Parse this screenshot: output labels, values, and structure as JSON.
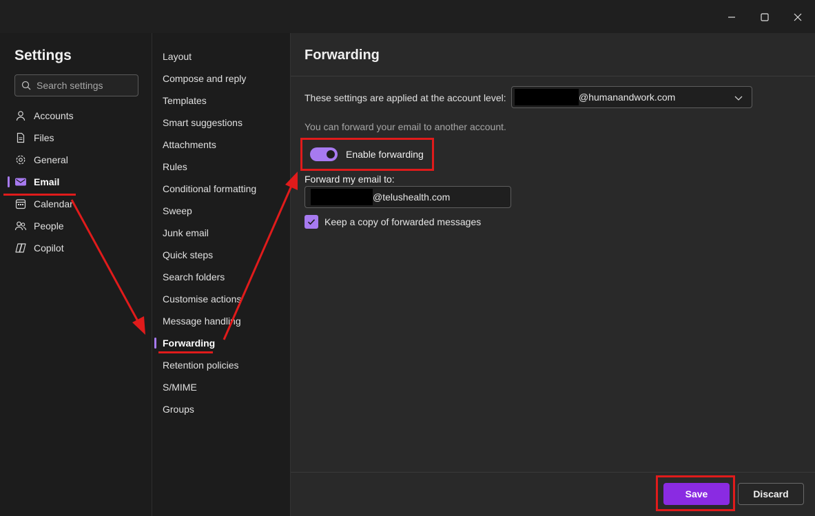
{
  "window": {
    "controls": [
      "minimize",
      "maximize",
      "close"
    ]
  },
  "settings": {
    "title": "Settings",
    "search_placeholder": "Search settings",
    "nav": [
      {
        "label": "Accounts",
        "icon": "person-icon"
      },
      {
        "label": "Files",
        "icon": "file-icon"
      },
      {
        "label": "General",
        "icon": "gear-icon"
      },
      {
        "label": "Email",
        "icon": "mail-icon",
        "active": true
      },
      {
        "label": "Calendar",
        "icon": "calendar-icon"
      },
      {
        "label": "People",
        "icon": "people-icon"
      },
      {
        "label": "Copilot",
        "icon": "copilot-icon"
      }
    ]
  },
  "email_menu": {
    "items": [
      "Layout",
      "Compose and reply",
      "Templates",
      "Smart suggestions",
      "Attachments",
      "Rules",
      "Conditional formatting",
      "Sweep",
      "Junk email",
      "Quick steps",
      "Search folders",
      "Customise actions",
      "Message handling",
      "Forwarding",
      "Retention policies",
      "S/MIME",
      "Groups"
    ],
    "active": "Forwarding"
  },
  "forwarding": {
    "title": "Forwarding",
    "account_label": "These settings are applied at the account level:",
    "account_domain": "@humanandwork.com",
    "info": "You can forward your email to another account.",
    "toggle_label": "Enable forwarding",
    "toggle_on": true,
    "forward_label": "Forward my email to:",
    "forward_domain": "@telushealth.com",
    "keep_copy_label": "Keep a copy of forwarded messages",
    "keep_copy_checked": true
  },
  "footer": {
    "save": "Save",
    "discard": "Discard"
  },
  "colors": {
    "accent": "#a77af0",
    "save_button": "#8a2be2",
    "annotation_red": "#e01b1b"
  }
}
